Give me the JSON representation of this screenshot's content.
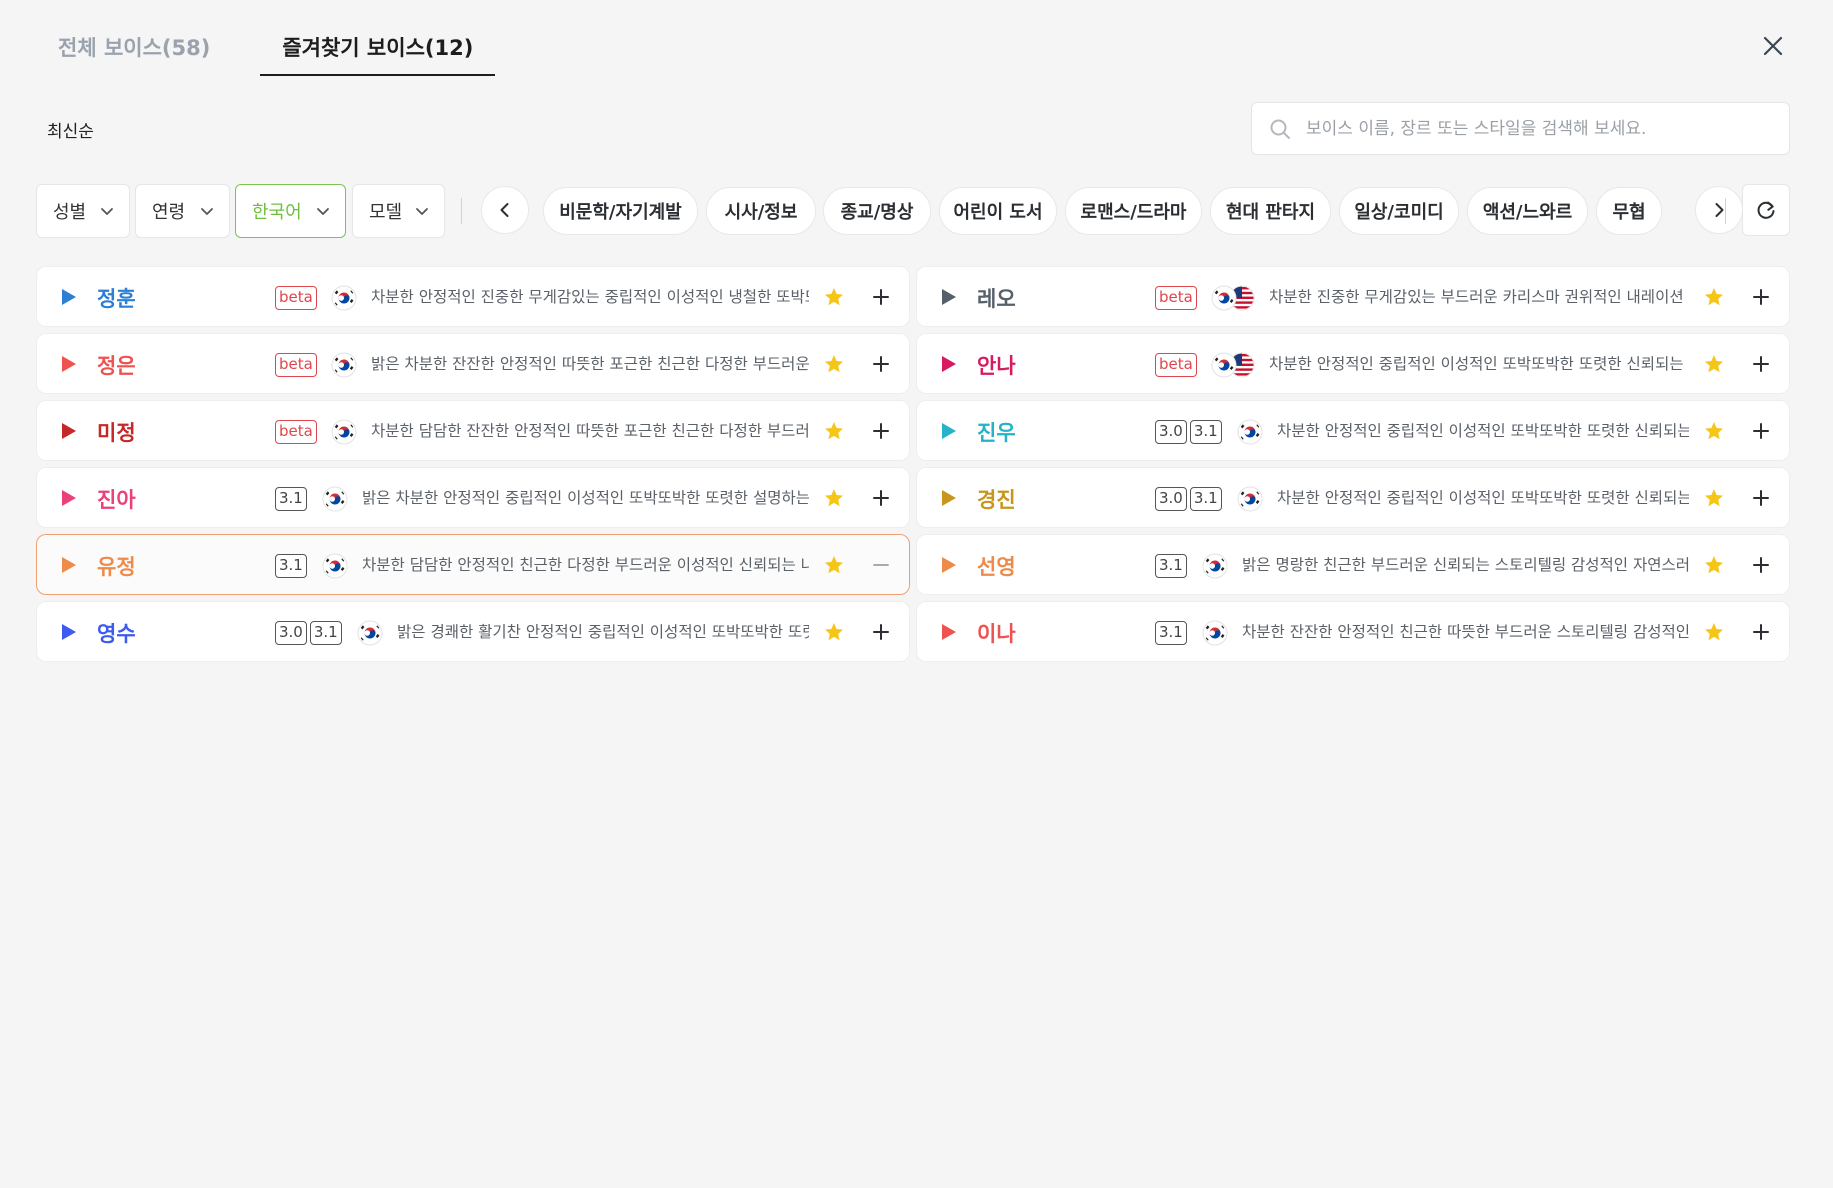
{
  "tabs": [
    {
      "label": "전체 보이스(58)",
      "active": false
    },
    {
      "label": "즐겨찾기 보이스(12)",
      "active": true
    }
  ],
  "sort": {
    "label": "최신순"
  },
  "search": {
    "placeholder": "보이스 이름, 장르 또는 스타일을 검색해 보세요.",
    "value": ""
  },
  "filters": {
    "dropdowns": [
      {
        "label": "성별",
        "active": false
      },
      {
        "label": "연령",
        "active": false
      },
      {
        "label": "한국어",
        "active": true
      },
      {
        "label": "모델",
        "active": false
      }
    ],
    "genres": [
      "비문학/자기계발",
      "시사/정보",
      "종교/명상",
      "어린이 도서",
      "로맨스/드라마",
      "현대 판타지",
      "일상/코미디",
      "액션/느와르",
      "무협"
    ]
  },
  "colors": {
    "accent_green": "#7cc44e",
    "selected_border": "#f0a070",
    "star": "#f5c518",
    "beta": "#e0474c"
  },
  "icons": {
    "close": "close-icon",
    "search": "search-icon",
    "prev": "chevron-left-icon",
    "next": "chevron-right-icon",
    "reset": "refresh-icon",
    "favorite": "star-icon",
    "add": "plus-icon",
    "remove": "minus-icon"
  },
  "voices": [
    {
      "name": "정훈",
      "color": "#2b7fd4",
      "badges": [
        "beta"
      ],
      "flags": [
        "kr"
      ],
      "desc": "차분한 안정적인 진중한 무게감있는 중립적인 이성적인 냉철한 또박또박한",
      "selected": false,
      "action": "add"
    },
    {
      "name": "레오",
      "color": "#55606b",
      "badges": [
        "beta"
      ],
      "flags": [
        "kr",
        "us"
      ],
      "desc": "차분한 진중한 무게감있는 부드러운 카리스마 권위적인 내레이션",
      "selected": false,
      "action": "add"
    },
    {
      "name": "정은",
      "color": "#ef5350",
      "badges": [
        "beta"
      ],
      "flags": [
        "kr"
      ],
      "desc": "밝은 차분한 잔잔한 안정적인 따뜻한 포근한 친근한 다정한 부드러운",
      "selected": false,
      "action": "add"
    },
    {
      "name": "안나",
      "color": "#d81b60",
      "badges": [
        "beta"
      ],
      "flags": [
        "kr",
        "us"
      ],
      "desc": "차분한 안정적인 중립적인 이성적인 또박또박한 또렷한 신뢰되는",
      "selected": false,
      "action": "add"
    },
    {
      "name": "미정",
      "color": "#c62828",
      "badges": [
        "beta"
      ],
      "flags": [
        "kr"
      ],
      "desc": "차분한 담담한 잔잔한 안정적인 따뜻한 포근한 친근한 다정한 부드러운",
      "selected": false,
      "action": "add"
    },
    {
      "name": "진우",
      "color": "#26b3c9",
      "badges": [
        "3.0",
        "3.1"
      ],
      "flags": [
        "kr"
      ],
      "desc": "차분한 안정적인 중립적인 이성적인 또박또박한 또렷한 신뢰되는",
      "selected": false,
      "action": "add"
    },
    {
      "name": "진아",
      "color": "#ec407a",
      "badges": [
        "3.1"
      ],
      "flags": [
        "kr"
      ],
      "desc": "밝은 차분한 안정적인 중립적인 이성적인 또박또박한 또렷한 설명하는",
      "selected": false,
      "action": "add"
    },
    {
      "name": "경진",
      "color": "#c9961c",
      "badges": [
        "3.0",
        "3.1"
      ],
      "flags": [
        "kr"
      ],
      "desc": "차분한 안정적인 중립적인 이성적인 또박또박한 또렷한 신뢰되는",
      "selected": false,
      "action": "add"
    },
    {
      "name": "유정",
      "color": "#ee8a4a",
      "badges": [
        "3.1"
      ],
      "flags": [
        "kr"
      ],
      "desc": "차분한 담담한 안정적인 친근한 다정한 부드러운 이성적인 신뢰되는 나",
      "selected": true,
      "action": "remove"
    },
    {
      "name": "선영",
      "color": "#ee8a4a",
      "badges": [
        "3.1"
      ],
      "flags": [
        "kr"
      ],
      "desc": "밝은 명랑한 친근한 부드러운 신뢰되는 스토리텔링 감성적인 자연스러운",
      "selected": false,
      "action": "add"
    },
    {
      "name": "영수",
      "color": "#3d5af1",
      "badges": [
        "3.0",
        "3.1"
      ],
      "flags": [
        "kr"
      ],
      "desc": "밝은 경쾌한 활기찬 안정적인 중립적인 이성적인 또박또박한 또렷한",
      "selected": false,
      "action": "add"
    },
    {
      "name": "이나",
      "color": "#ef5350",
      "badges": [
        "3.1"
      ],
      "flags": [
        "kr"
      ],
      "desc": "차분한 잔잔한 안정적인 친근한 따뜻한 부드러운 스토리텔링 감성적인",
      "selected": false,
      "action": "add"
    }
  ]
}
